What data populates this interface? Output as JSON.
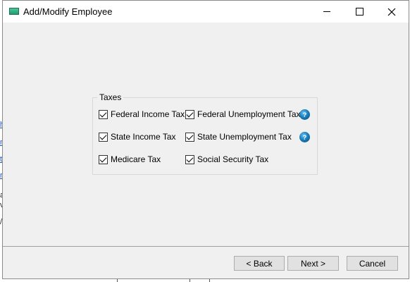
{
  "window": {
    "title": "Add/Modify Employee",
    "controls": {
      "minimize": "minimize",
      "maximize": "maximize",
      "close": "close"
    }
  },
  "taxes": {
    "legend": "Taxes",
    "items": [
      {
        "label": "Federal Income Tax",
        "checked": true
      },
      {
        "label": "Federal Unemployment Tax",
        "checked": true,
        "help": true
      },
      {
        "label": "State Income Tax",
        "checked": true
      },
      {
        "label": "State Unemployment Tax",
        "checked": true,
        "help": true
      },
      {
        "label": "Medicare Tax",
        "checked": true
      },
      {
        "label": "Social Security Tax",
        "checked": true
      }
    ]
  },
  "buttons": {
    "back": "< Back",
    "next": "Next >",
    "cancel": "Cancel"
  },
  "background": {
    "link_chars": [
      "h",
      "n",
      "t",
      "r"
    ],
    "text_chars": [
      "a",
      "v",
      "/"
    ]
  },
  "colors": {
    "window_bg": "#f0f0f0",
    "titlebar_bg": "#ffffff",
    "help_icon": "#1a7fbf"
  }
}
